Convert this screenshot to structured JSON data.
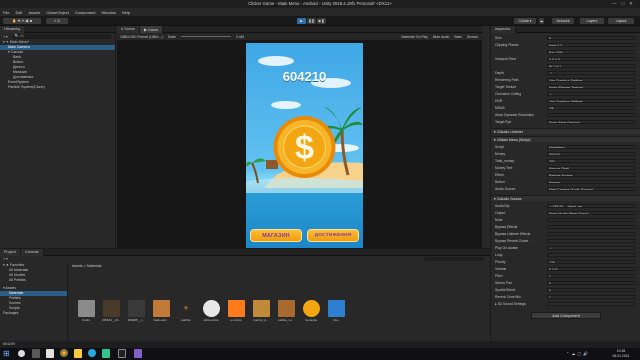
{
  "window": {
    "title": "Clicker Game - Main Menu - Android - Unity 2019.4.19f1 Personal* <DX11>"
  },
  "menu": [
    "File",
    "Edit",
    "Assets",
    "GameObject",
    "Component",
    "Window",
    "Help"
  ],
  "toolbar": {
    "collab": "Collab ▾",
    "account": "Account",
    "layers": "Layers",
    "layout": "Layout"
  },
  "hierarchy": {
    "tab": "Hierarchy",
    "create": "+ ▾",
    "search_placeholder": "All",
    "items": [
      {
        "label": "▾ ✶ Main Menu*",
        "level": 0,
        "selected": false
      },
      {
        "label": "Main Camera",
        "level": 1,
        "selected": true
      },
      {
        "label": "▾ Canvas",
        "level": 1,
        "selected": false
      },
      {
        "label": "Bank",
        "level": 2,
        "selected": false
      },
      {
        "label": "Button",
        "level": 2,
        "selected": false
      },
      {
        "label": "Деньги",
        "level": 2,
        "selected": false
      },
      {
        "label": "Магазин",
        "level": 2,
        "selected": false
      },
      {
        "label": "Достижения",
        "level": 2,
        "selected": false
      },
      {
        "label": "EventSystem",
        "level": 1,
        "selected": false
      },
      {
        "label": "Particle System(Clone)",
        "level": 1,
        "selected": false
      }
    ]
  },
  "scene": {
    "tab_scene": "# Scene",
    "tab_game": "▶ Game",
    "display": "1080x1920 Portrait (1080x...)",
    "scale_label": "Scale",
    "scale_value": "0.445",
    "options": [
      "Maximize On Play",
      "Mute Audio",
      "Stats",
      "Gizmos"
    ]
  },
  "game": {
    "score": "604210",
    "shop_button": "МАГАЗИН",
    "achievements_button": "ДОСТИЖЕНИЯ",
    "coin_symbol": "$"
  },
  "inspector": {
    "tab": "Inspector",
    "rows": [
      {
        "label": "Size",
        "value": "5"
      },
      {
        "label": "Clipping Planes",
        "value": "Near  0.3"
      },
      {
        "label": "",
        "value": "Far   1000"
      },
      {
        "label": "Viewport Rect",
        "value": "X 0   Y 0"
      },
      {
        "label": "",
        "value": "W 1   H 1"
      },
      {
        "label": "Depth",
        "value": "-1"
      },
      {
        "label": "Rendering Path",
        "value": "Use Graphics Settings"
      },
      {
        "label": "Target Texture",
        "value": "None (Render Texture)"
      },
      {
        "label": "Occlusion Culling",
        "value": "✓"
      },
      {
        "label": "HDR",
        "value": "Use Graphics Settings"
      },
      {
        "label": "MSAA",
        "value": "Off"
      },
      {
        "label": "Allow Dynamic Resolution",
        "value": ""
      },
      {
        "label": "Target Eye",
        "value": "None (Main Display)"
      }
    ],
    "components": [
      {
        "name": "Audio Listener"
      },
      {
        "name": "Main Menu (Script)"
      }
    ],
    "script_rows": [
      {
        "label": "Script",
        "value": "MainMenu"
      },
      {
        "label": "Money",
        "value": "604210"
      },
      {
        "label": "Total_money",
        "value": "700"
      },
      {
        "label": "Money Text",
        "value": "Деньги (Text)"
      },
      {
        "label": "Effect",
        "value": "Particle System"
      },
      {
        "label": "Button",
        "value": "Кнопка"
      },
      {
        "label": "Audio Source",
        "value": "Main Camera (Audio Source)"
      }
    ],
    "audio_source": "Audio Source",
    "audio_rows": [
      {
        "label": "AudioClip",
        "value": "♫ 335181__dland_tre"
      },
      {
        "label": "Output",
        "value": "None (Audio Mixer Group)"
      },
      {
        "label": "Mute",
        "value": ""
      },
      {
        "label": "Bypass Effects",
        "value": ""
      },
      {
        "label": "Bypass Listener Effects",
        "value": ""
      },
      {
        "label": "Bypass Reverb Zones",
        "value": ""
      },
      {
        "label": "Play On Awake",
        "value": "✓"
      },
      {
        "label": "Loop",
        "value": ""
      },
      {
        "label": "Priority",
        "value": "128"
      },
      {
        "label": "Volume",
        "value": "0.143"
      },
      {
        "label": "Pitch",
        "value": "1"
      },
      {
        "label": "Stereo Pan",
        "value": "0"
      },
      {
        "label": "Spatial Blend",
        "value": "0"
      },
      {
        "label": "Reverb Zone Mix",
        "value": "1"
      },
      {
        "label": "▸ 3D Sound Settings",
        "value": ""
      }
    ],
    "add_component": "Add Component"
  },
  "project": {
    "tab_project": "Project",
    "tab_console": "Console",
    "create": "+ ▾",
    "favorites": [
      "▾ ★ Favorites",
      "All Materials",
      "All Models",
      "All Prefabs"
    ],
    "tree": [
      {
        "label": "▾ Assets",
        "selected": false
      },
      {
        "label": "Materials",
        "selected": true
      },
      {
        "label": "Prefabs",
        "selected": false
      },
      {
        "label": "Scenes",
        "selected": false
      },
      {
        "label": "Scripts",
        "selected": false
      },
      {
        "label": "Packages",
        "selected": false
      }
    ],
    "breadcrumb": "Assets > Materials",
    "assets": [
      "Fonts",
      "335181__dl...",
      "384985__t...",
      "back-cart...",
      "particle",
      "white-circle",
      "e-xcoins",
      "interior_p...",
      "outline_vv...",
      "moneybo",
      "bso"
    ]
  },
  "status": {
    "text": "604209"
  },
  "taskbar": {
    "time": "10:35",
    "date": "06.01.2021"
  },
  "colors": {
    "accent": "#2c5d87",
    "button_orange": "#f6a31b",
    "button_text": "#7b3ba0",
    "coin": "#f3a512"
  }
}
